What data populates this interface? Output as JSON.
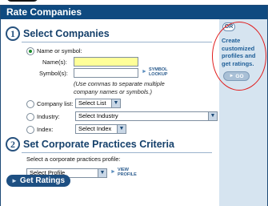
{
  "panel": {
    "title": "Rate Companies"
  },
  "section1": {
    "number": "1",
    "title": "Select Companies",
    "name_or_symbol_label": "Name or symbol:",
    "names_label": "Name(s):",
    "names_value": "",
    "symbols_label": "Symbol(s):",
    "symbols_value": "",
    "symbol_lookup_line1": "SYMBOL",
    "symbol_lookup_line2": "LOOKUP",
    "hint_line1": "(Use commas to separate multiple",
    "hint_line2": "company names or symbols.)",
    "company_list_label": "Company list:",
    "company_list_value": "Select List",
    "industry_label": "Industry:",
    "industry_value": "Select Industry",
    "index_label": "Index:",
    "index_value": "Select Index",
    "selected_option": "name_or_symbol"
  },
  "section2": {
    "number": "2",
    "title": "Set Corporate Practices Criteria",
    "instruction": "Select a corporate practices profile:",
    "profile_value": "Select Profile",
    "view_profile_line1": "VIEW",
    "view_profile_line2": "PROFILE"
  },
  "actions": {
    "get_ratings_label": "Get Ratings"
  },
  "sidebar": {
    "or_label": "OR",
    "line1": "Create",
    "line2": "customized",
    "line3": "profiles and",
    "line4": "get ratings.",
    "go_label": "GO"
  },
  "colors": {
    "header": "#0f4a80",
    "sidebar_bg": "#d6e4f0",
    "accent_text": "#1f5f98",
    "highlight_ring": "#e11b1b",
    "input_highlight": "#ffff99"
  }
}
